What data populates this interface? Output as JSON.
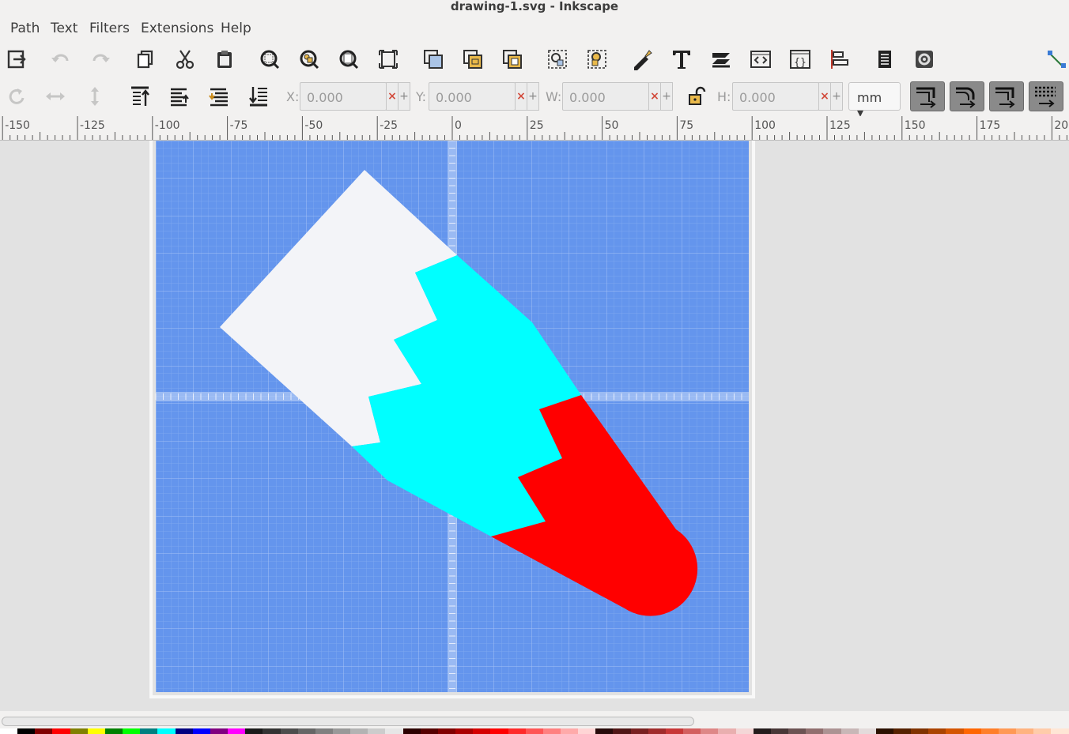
{
  "window": {
    "title": "drawing-1.svg - Inkscape"
  },
  "menu": {
    "items": [
      "Path",
      "Text",
      "Filters",
      "Extensions",
      "Help"
    ]
  },
  "toolbar2": {
    "x_label": "X:",
    "x_value": "0.000",
    "y_label": "Y:",
    "y_value": "0.000",
    "w_label": "W:",
    "w_value": "0.000",
    "h_label": "H:",
    "h_value": "0.000",
    "unit": "mm",
    "lock_state": "unlocked"
  },
  "ruler": {
    "labels": [
      "-150",
      "-125",
      "-100",
      "-75",
      "-50",
      "-25",
      "0",
      "25",
      "50",
      "75",
      "100",
      "125",
      "150",
      "175",
      "200"
    ]
  },
  "canvas": {
    "page_color": "#6495ed",
    "shapes": [
      {
        "name": "white-shape",
        "color": "#f3f4f8"
      },
      {
        "name": "cyan-shape",
        "color": "#00ffff"
      },
      {
        "name": "red-shape",
        "color": "#ff0000"
      }
    ]
  },
  "palette": {
    "colors": [
      "#ffffff",
      "#000000",
      "#800000",
      "#ff0000",
      "#808000",
      "#ffff00",
      "#008000",
      "#00ff00",
      "#008080",
      "#00ffff",
      "#000080",
      "#0000ff",
      "#800080",
      "#ff00ff",
      "#1a1a1a",
      "#333333",
      "#4d4d4d",
      "#666666",
      "#808080",
      "#999999",
      "#b3b3b3",
      "#cccccc",
      "#e6e6e6",
      "#2b0000",
      "#550000",
      "#800000",
      "#aa0000",
      "#d40000",
      "#ff0000",
      "#ff2a2a",
      "#ff5555",
      "#ff8080",
      "#ffaaaa",
      "#ffd5d5",
      "#280b0b",
      "#501616",
      "#782121",
      "#a02c2c",
      "#c83737",
      "#d35f5f",
      "#de8787",
      "#e9afaf",
      "#f4d7d7",
      "#241c1c",
      "#483737",
      "#6c5353",
      "#916f6f",
      "#ac9393",
      "#c8b7b7",
      "#e3dbdb",
      "#2b1100",
      "#552200",
      "#803300",
      "#aa4400",
      "#d45500",
      "#ff6600",
      "#ff7f2a",
      "#ff9955",
      "#ffb380",
      "#ffccaa",
      "#ffe6d5"
    ]
  }
}
